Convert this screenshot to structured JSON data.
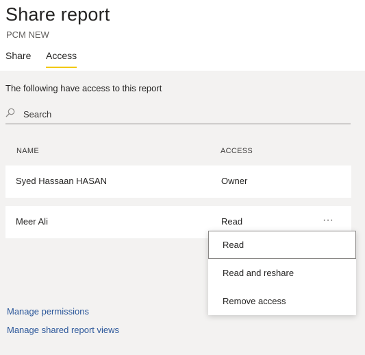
{
  "header": {
    "title": "Share report",
    "subtitle": "PCM NEW"
  },
  "tabs": [
    {
      "label": "Share",
      "active": false
    },
    {
      "label": "Access",
      "active": true
    }
  ],
  "access_panel": {
    "intro": "The following have access to this report",
    "search": {
      "placeholder": "Search",
      "value": "",
      "icon": "search-icon"
    },
    "columns": {
      "name": "NAME",
      "access": "ACCESS"
    },
    "rows": [
      {
        "name": "Syed Hassaan HASAN",
        "access": "Owner"
      },
      {
        "name": "Meer Ali",
        "access": "Read",
        "more": "···"
      }
    ],
    "dropdown": {
      "options": [
        "Read",
        "Read and reshare",
        "Remove access"
      ],
      "selected": "Read"
    },
    "links": {
      "manage_permissions": "Manage permissions",
      "manage_shared_views": "Manage shared report views"
    }
  },
  "colors": {
    "accent": "#f2c811",
    "panel_bg": "#f3f2f1",
    "link": "#2b579a"
  }
}
